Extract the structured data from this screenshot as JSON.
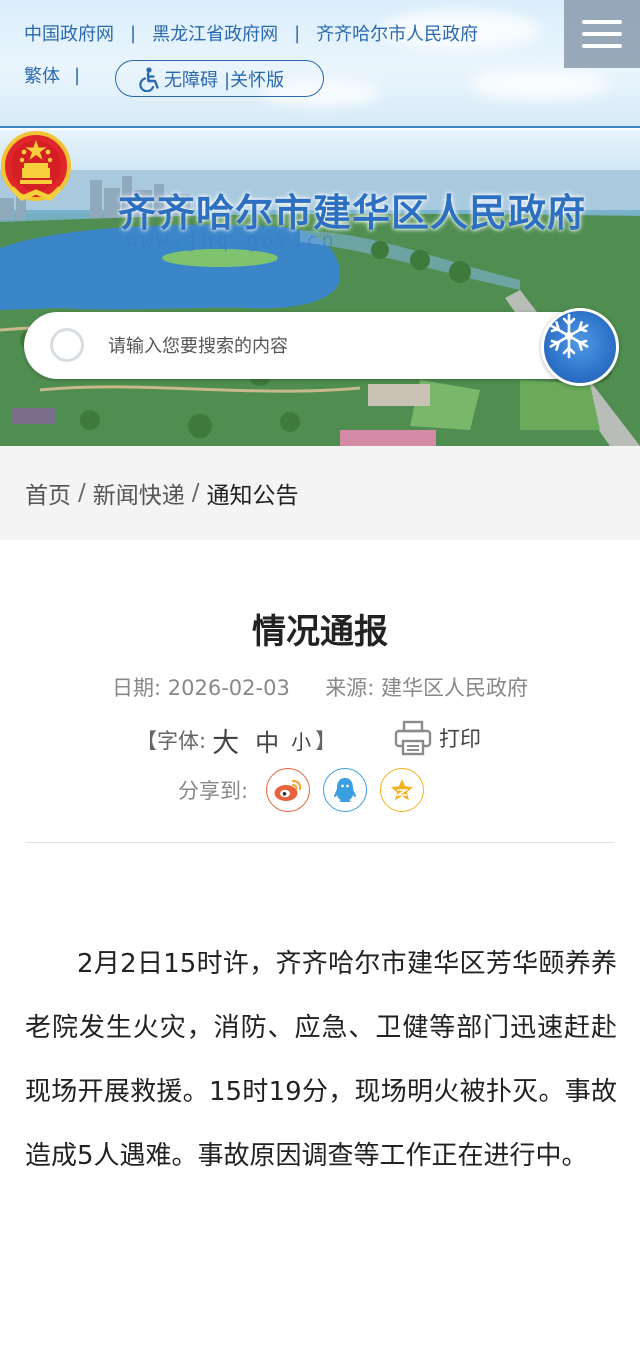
{
  "top_links": {
    "gov_cn": "中国政府网",
    "hlj_gov": "黑龙江省政府网",
    "qqhr_gov": "齐齐哈尔市人民政府",
    "separator": "|"
  },
  "top_row2": {
    "traditional": "繁体",
    "separator": "|",
    "accessibility": "无障碍",
    "care_version": "|关怀版"
  },
  "icons": {
    "menu": "menu-icon",
    "wheelchair": "wheelchair-icon",
    "search": "search-icon",
    "print": "printer-icon",
    "weibo": "weibo-icon",
    "qq": "qq-icon",
    "qzone": "qzone-star-icon"
  },
  "banner": {
    "site_title": "齐齐哈尔市建华区人民政府",
    "site_url": "www.jhq.gov.cn"
  },
  "search": {
    "placeholder": "请输入您要搜索的内容"
  },
  "breadcrumb": {
    "home": "首页",
    "news": "新闻快递",
    "current": "通知公告",
    "separator": "/"
  },
  "article": {
    "title": "情况通报",
    "date_label": "日期:",
    "date": "2026-02-03",
    "source_label": "来源:",
    "source": "建华区人民政府",
    "font_label": "【字体:",
    "font_large": "大",
    "font_medium": "中",
    "font_small": "小",
    "font_close": "】",
    "print_label": "打印",
    "share_label": "分享到:",
    "body": "2月2日15时许，齐齐哈尔市建华区芳华颐养养老院发生火灾，消防、应急、卫健等部门迅速赶赴现场开展救援。15时19分，现场明火被扑灭。事故造成5人遇难。事故原因调查等工作正在进行中。"
  },
  "colors": {
    "link_blue": "#2a69b0",
    "title_blue": "#2d6fc0",
    "weibo": "#e8623c",
    "qq": "#3a9fe0",
    "qzone": "#f2b221"
  }
}
